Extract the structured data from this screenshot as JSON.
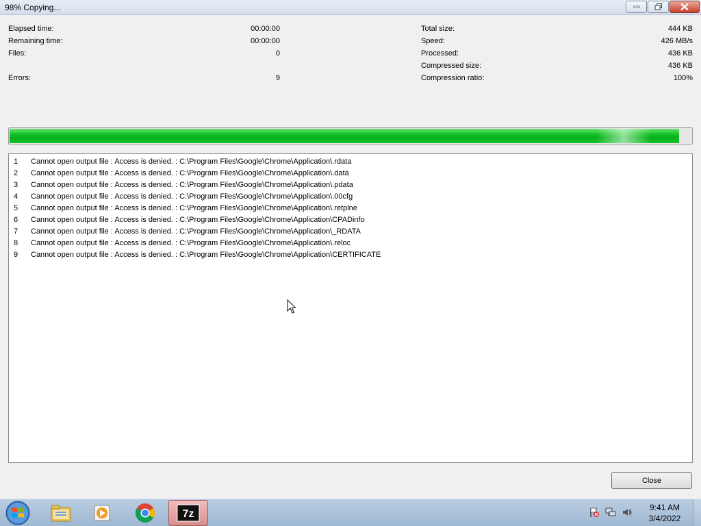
{
  "window": {
    "title": "98% Copying..."
  },
  "stats_left": [
    {
      "label": "Elapsed time:",
      "value": "00:00:00"
    },
    {
      "label": "Remaining time:",
      "value": "00:00:00"
    },
    {
      "label": "Files:",
      "value": "0"
    },
    {
      "label": "Errors:",
      "value": "9"
    }
  ],
  "stats_right": [
    {
      "label": "Total size:",
      "value": "444 KB"
    },
    {
      "label": "Speed:",
      "value": "426 MB/s"
    },
    {
      "label": "Processed:",
      "value": "436 KB"
    },
    {
      "label": "Compressed size:",
      "value": "436 KB"
    },
    {
      "label": "Compression ratio:",
      "value": "100%"
    }
  ],
  "progress": {
    "fraction": 0.98
  },
  "errors": [
    {
      "num": "1",
      "message": "Cannot open output file : Access is denied. : C:\\Program Files\\Google\\Chrome\\Application\\.rdata"
    },
    {
      "num": "2",
      "message": "Cannot open output file : Access is denied. : C:\\Program Files\\Google\\Chrome\\Application\\.data"
    },
    {
      "num": "3",
      "message": "Cannot open output file : Access is denied. : C:\\Program Files\\Google\\Chrome\\Application\\.pdata"
    },
    {
      "num": "4",
      "message": "Cannot open output file : Access is denied. : C:\\Program Files\\Google\\Chrome\\Application\\.00cfg"
    },
    {
      "num": "5",
      "message": "Cannot open output file : Access is denied. : C:\\Program Files\\Google\\Chrome\\Application\\.retplne"
    },
    {
      "num": "6",
      "message": "Cannot open output file : Access is denied. : C:\\Program Files\\Google\\Chrome\\Application\\CPADinfo"
    },
    {
      "num": "7",
      "message": "Cannot open output file : Access is denied. : C:\\Program Files\\Google\\Chrome\\Application\\_RDATA"
    },
    {
      "num": "8",
      "message": "Cannot open output file : Access is denied. : C:\\Program Files\\Google\\Chrome\\Application\\.reloc"
    },
    {
      "num": "9",
      "message": "Cannot open output file : Access is denied. : C:\\Program Files\\Google\\Chrome\\Application\\CERTIFICATE"
    }
  ],
  "buttons": {
    "close_label": "Close"
  },
  "taskbar": {
    "items": [
      "windows-start-icon",
      "file-explorer-icon",
      "media-player-icon",
      "chrome-icon",
      "7zip-icon"
    ],
    "active_app_label": "7z",
    "tray_icons": [
      "action-center-flag-icon",
      "network-icon",
      "volume-icon"
    ],
    "time": "9:41 AM",
    "date": "3/4/2022"
  },
  "colors": {
    "progress_green": "#06b01a",
    "active_task": "#d98d8d",
    "taskbar": "#a9c0d8"
  }
}
